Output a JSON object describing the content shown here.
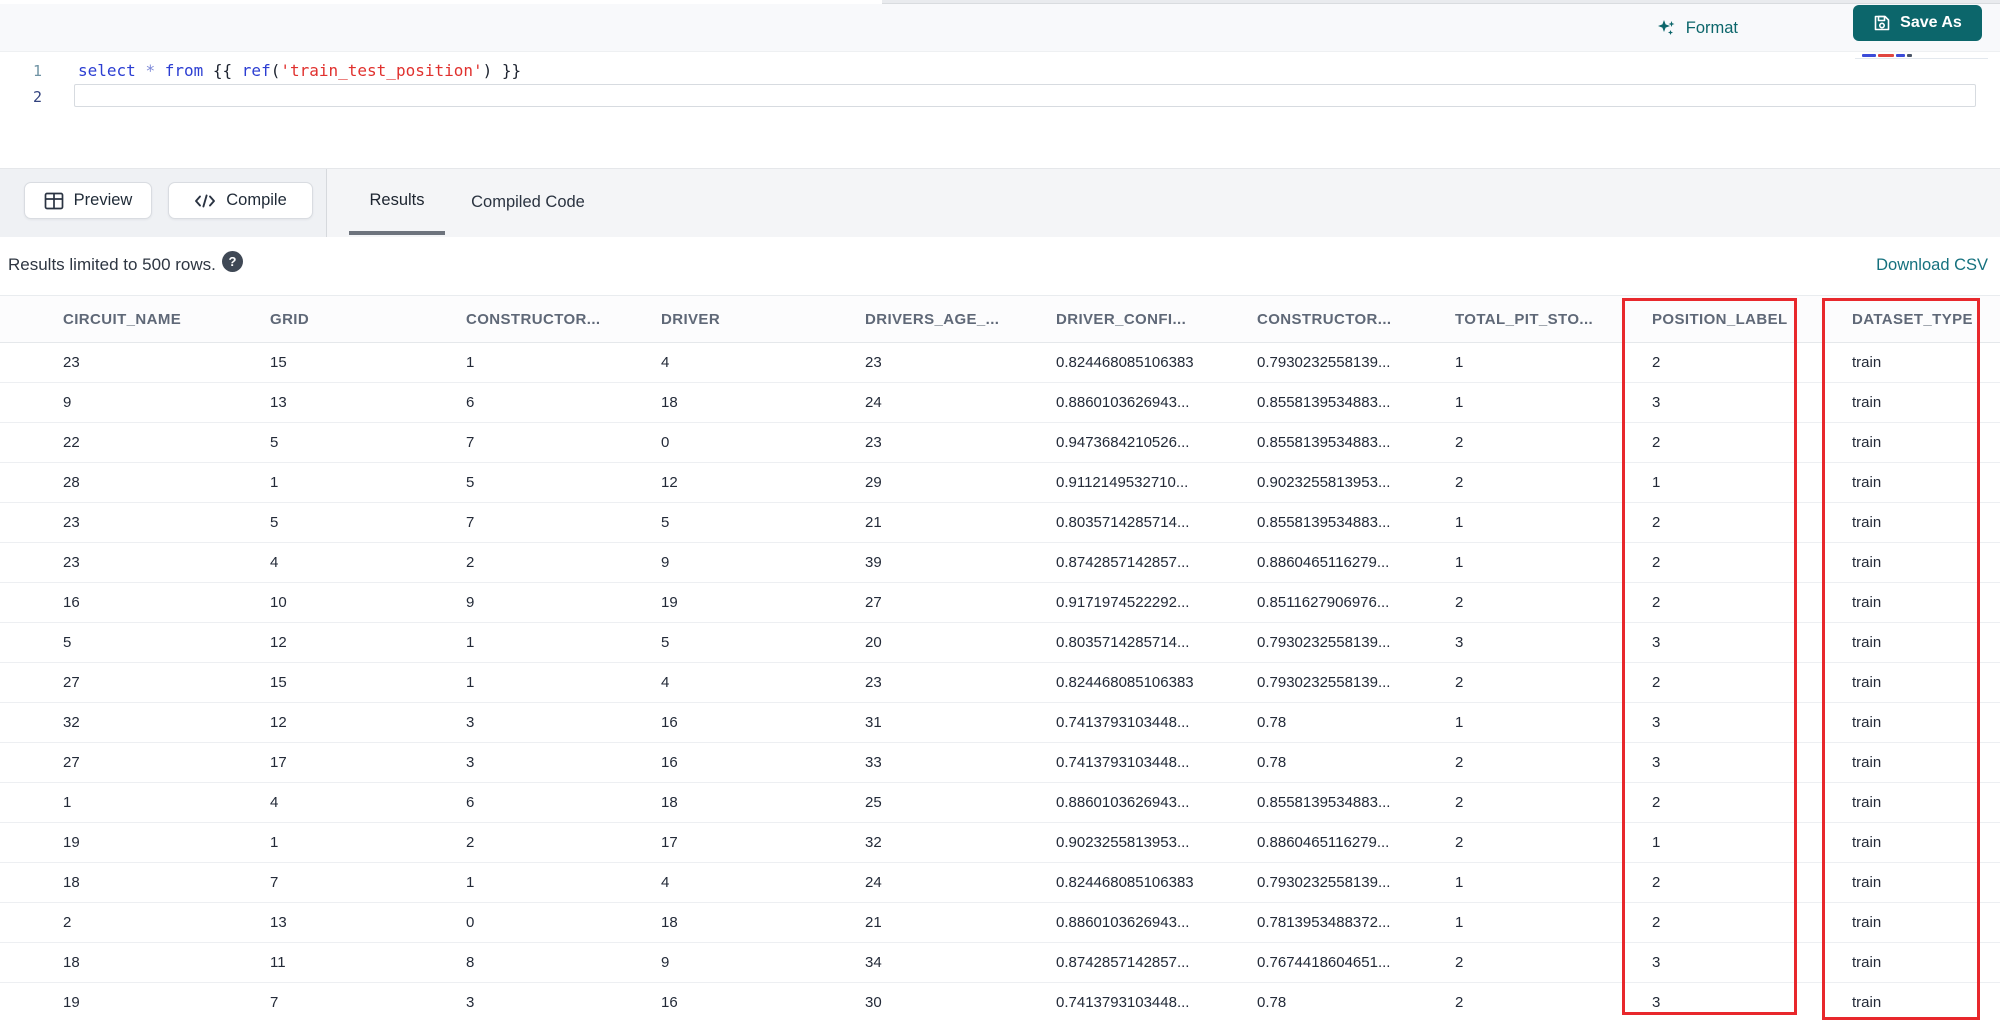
{
  "colors": {
    "accent_teal": "#0c666b",
    "link_teal": "#15717e",
    "annotation_red": "#e8282c",
    "syntax_keyword": "#2c3ed2",
    "syntax_operator": "#7b87d7",
    "syntax_bracket": "#1d2330",
    "syntax_string": "#e0312e"
  },
  "toolbar": {
    "format_label": "Format",
    "save_as_label": "Save As"
  },
  "editor": {
    "line_numbers": [
      "1",
      "2"
    ],
    "code_tokens": [
      {
        "t": "select",
        "c": "keyword"
      },
      {
        "t": " ",
        "c": "plain"
      },
      {
        "t": "*",
        "c": "operator"
      },
      {
        "t": " ",
        "c": "plain"
      },
      {
        "t": "from",
        "c": "keyword"
      },
      {
        "t": " ",
        "c": "plain"
      },
      {
        "t": "{{ ",
        "c": "bracket"
      },
      {
        "t": "ref",
        "c": "keyword"
      },
      {
        "t": "(",
        "c": "bracket"
      },
      {
        "t": "'train_test_position'",
        "c": "string"
      },
      {
        "t": ")",
        "c": "bracket"
      },
      {
        "t": " }}",
        "c": "bracket"
      }
    ]
  },
  "actions": {
    "preview_label": "Preview",
    "compile_label": "Compile"
  },
  "tabs": [
    {
      "label": "Results",
      "active": true
    },
    {
      "label": "Compiled Code",
      "active": false
    }
  ],
  "results_bar": {
    "limit_text": "Results limited to 500 rows.",
    "help_icon": "?",
    "download_label": "Download CSV"
  },
  "results_table": {
    "columns": [
      "CIRCUIT_NAME",
      "GRID",
      "CONSTRUCTOR...",
      "DRIVER",
      "DRIVERS_AGE_...",
      "DRIVER_CONFI...",
      "CONSTRUCTOR...",
      "TOTAL_PIT_STO...",
      "POSITION_LABEL",
      "DATASET_TYPE"
    ],
    "highlighted_columns": [
      "POSITION_LABEL",
      "DATASET_TYPE"
    ],
    "rows": [
      [
        "23",
        "15",
        "1",
        "4",
        "23",
        "0.824468085106383",
        "0.7930232558139...",
        "1",
        "2",
        "train"
      ],
      [
        "9",
        "13",
        "6",
        "18",
        "24",
        "0.8860103626943...",
        "0.8558139534883...",
        "1",
        "3",
        "train"
      ],
      [
        "22",
        "5",
        "7",
        "0",
        "23",
        "0.9473684210526...",
        "0.8558139534883...",
        "2",
        "2",
        "train"
      ],
      [
        "28",
        "1",
        "5",
        "12",
        "29",
        "0.9112149532710...",
        "0.9023255813953...",
        "2",
        "1",
        "train"
      ],
      [
        "23",
        "5",
        "7",
        "5",
        "21",
        "0.8035714285714...",
        "0.8558139534883...",
        "1",
        "2",
        "train"
      ],
      [
        "23",
        "4",
        "2",
        "9",
        "39",
        "0.8742857142857...",
        "0.8860465116279...",
        "1",
        "2",
        "train"
      ],
      [
        "16",
        "10",
        "9",
        "19",
        "27",
        "0.9171974522292...",
        "0.8511627906976...",
        "2",
        "2",
        "train"
      ],
      [
        "5",
        "12",
        "1",
        "5",
        "20",
        "0.8035714285714...",
        "0.7930232558139...",
        "3",
        "3",
        "train"
      ],
      [
        "27",
        "15",
        "1",
        "4",
        "23",
        "0.824468085106383",
        "0.7930232558139...",
        "2",
        "2",
        "train"
      ],
      [
        "32",
        "12",
        "3",
        "16",
        "31",
        "0.7413793103448...",
        "0.78",
        "1",
        "3",
        "train"
      ],
      [
        "27",
        "17",
        "3",
        "16",
        "33",
        "0.7413793103448...",
        "0.78",
        "2",
        "3",
        "train"
      ],
      [
        "1",
        "4",
        "6",
        "18",
        "25",
        "0.8860103626943...",
        "0.8558139534883...",
        "2",
        "2",
        "train"
      ],
      [
        "19",
        "1",
        "2",
        "17",
        "32",
        "0.9023255813953...",
        "0.8860465116279...",
        "2",
        "1",
        "train"
      ],
      [
        "18",
        "7",
        "1",
        "4",
        "24",
        "0.824468085106383",
        "0.7930232558139...",
        "1",
        "2",
        "train"
      ],
      [
        "2",
        "13",
        "0",
        "18",
        "21",
        "0.8860103626943...",
        "0.7813953488372...",
        "1",
        "2",
        "train"
      ],
      [
        "18",
        "11",
        "8",
        "9",
        "34",
        "0.8742857142857...",
        "0.7674418604651...",
        "2",
        "3",
        "train"
      ],
      [
        "19",
        "7",
        "3",
        "16",
        "30",
        "0.7413793103448...",
        "0.78",
        "2",
        "3",
        "train"
      ]
    ]
  }
}
